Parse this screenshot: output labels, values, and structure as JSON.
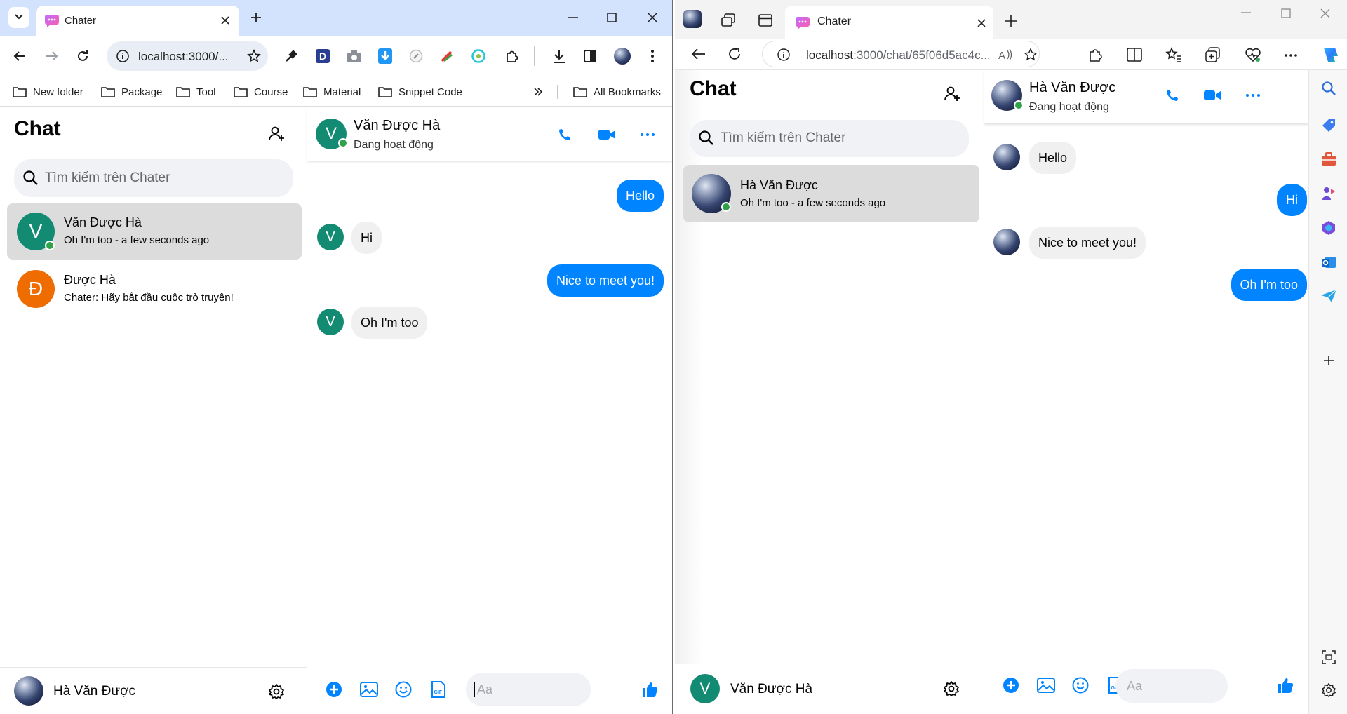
{
  "left_browser": {
    "tab_title": "Chater",
    "url": "localhost:3000/...",
    "bookmarks": [
      "New folder",
      "Package",
      "Tool",
      "Course",
      "Material",
      "Snippet Code"
    ],
    "all_bookmarks": "All Bookmarks",
    "extension_d": "D",
    "app": {
      "title": "Chat",
      "search_placeholder": "Tìm kiếm trên Chater",
      "conversations": [
        {
          "name": "Văn Được Hà",
          "last": "Oh I'm too - a few seconds ago",
          "initial": "V",
          "online": true,
          "active": true
        },
        {
          "name": "Được Hà",
          "last": "Chater: Hãy bắt đầu cuộc trò truyện!",
          "initial": "Đ",
          "online": false,
          "active": false
        }
      ],
      "current_user": "Hà Văn Được",
      "chat": {
        "partner_name": "Văn Được Hà",
        "partner_initial": "V",
        "status": "Đang hoạt động",
        "messages": [
          {
            "from": "me",
            "text": "Hello"
          },
          {
            "from": "them",
            "text": "Hi"
          },
          {
            "from": "me",
            "text": "Nice to meet you!"
          },
          {
            "from": "them",
            "text": "Oh I'm too"
          }
        ],
        "input_placeholder": "Aa"
      }
    }
  },
  "right_browser": {
    "tab_title": "Chater",
    "url_host": "localhost",
    "url_rest": ":3000/chat/65f06d5ac4c...",
    "app": {
      "title": "Chat",
      "search_placeholder": "Tìm kiếm trên Chater",
      "conversations": [
        {
          "name": "Hà Văn Được",
          "last": "Oh I'm too - a few seconds ago",
          "online": true,
          "active": true
        }
      ],
      "current_user": "Văn Được Hà",
      "current_user_initial": "V",
      "chat": {
        "partner_name": "Hà Văn Được",
        "status": "Đang hoạt động",
        "messages": [
          {
            "from": "them",
            "text": "Hello"
          },
          {
            "from": "me",
            "text": "Hi"
          },
          {
            "from": "them",
            "text": "Nice to meet you!"
          },
          {
            "from": "me",
            "text": "Oh I'm too"
          }
        ],
        "input_placeholder": "Aa"
      }
    }
  },
  "colors": {
    "accent": "#0084ff",
    "online": "#31a24c",
    "teal_avatar": "#138a72",
    "orange_avatar": "#ef6c00",
    "chrome_tabstrip": "#d3e3fd"
  },
  "icons": [
    "chevron-down-icon",
    "chater-logo-icon",
    "close-icon",
    "plus-icon",
    "minimize-icon",
    "maximize-icon",
    "back-icon",
    "forward-icon",
    "reload-icon",
    "info-icon",
    "star-icon",
    "eyedropper-icon",
    "camera-icon",
    "download-icon",
    "puzzle-icon",
    "sidebar-icon",
    "menu-icon",
    "folder-icon",
    "add-user-icon",
    "search-icon",
    "phone-icon",
    "video-icon",
    "more-icon",
    "plus-circle-icon",
    "image-icon",
    "emoji-icon",
    "gif-icon",
    "like-icon",
    "settings-icon"
  ]
}
